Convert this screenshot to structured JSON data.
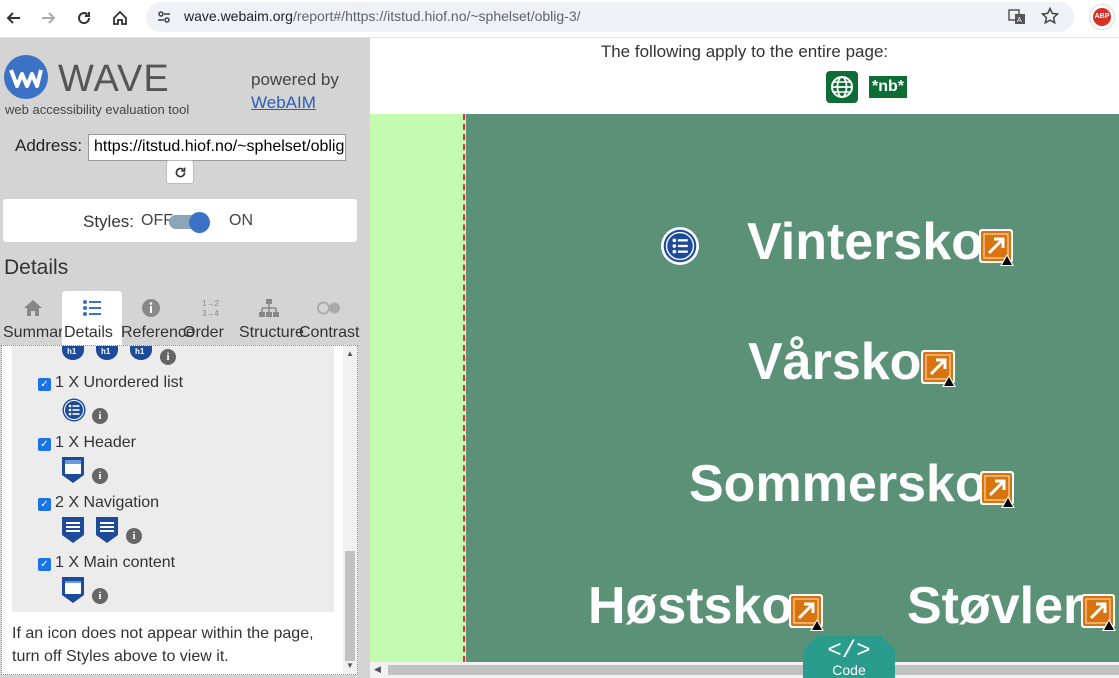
{
  "browser": {
    "url_host": "wave.webaim.org",
    "url_rest": "/report#/https://itstud.hiof.no/~sphelset/oblig-3/",
    "extension_badge": "ABP"
  },
  "wave": {
    "title": "WAVE",
    "subtitle": "web accessibility evaluation tool",
    "powered_by": "powered by",
    "webaim_link": "WebAIM",
    "address_label": "Address:",
    "address_value": "https://itstud.hiof.no/~sphelset/oblig-3/",
    "styles_label": "Styles:",
    "styles_off": "OFF",
    "styles_on": "ON",
    "styles_state": "on",
    "details_heading": "Details",
    "tabs": [
      {
        "label": "Summary",
        "icon": "home-icon"
      },
      {
        "label": "Details",
        "icon": "list-icon"
      },
      {
        "label": "Reference",
        "icon": "info-icon"
      },
      {
        "label": "Order",
        "icon": "order-icon"
      },
      {
        "label": "Structure",
        "icon": "structure-icon"
      },
      {
        "label": "Contrast",
        "icon": "contrast-icon"
      }
    ],
    "active_tab": "Details",
    "items": [
      {
        "label": "1 X Unordered list",
        "checked": true,
        "icons": [
          "unordered-list-icon"
        ]
      },
      {
        "label": "1 X Header",
        "checked": true,
        "icons": [
          "header-region-icon"
        ]
      },
      {
        "label": "2 X Navigation",
        "checked": true,
        "icons": [
          "navigation-icon",
          "navigation-icon"
        ]
      },
      {
        "label": "1 X Main content",
        "checked": true,
        "icons": [
          "main-content-icon"
        ]
      }
    ],
    "footnote": "If an icon does not appear within the page, turn off Styles above to view it."
  },
  "report": {
    "apply_text": "The following apply to the entire page:",
    "lang_badge": "*nb*",
    "links": [
      "Vintersko",
      "Vårsko",
      "Sommersko",
      "Høstsko",
      "Støvler"
    ],
    "code_symbol": "</>",
    "code_label": "Code"
  },
  "colors": {
    "page_green": "#5a9177",
    "side_green": "#c5fbb0",
    "wave_blue": "#3a73c6",
    "alert_orange": "#d9730d",
    "code_teal": "#2a9c8e"
  }
}
